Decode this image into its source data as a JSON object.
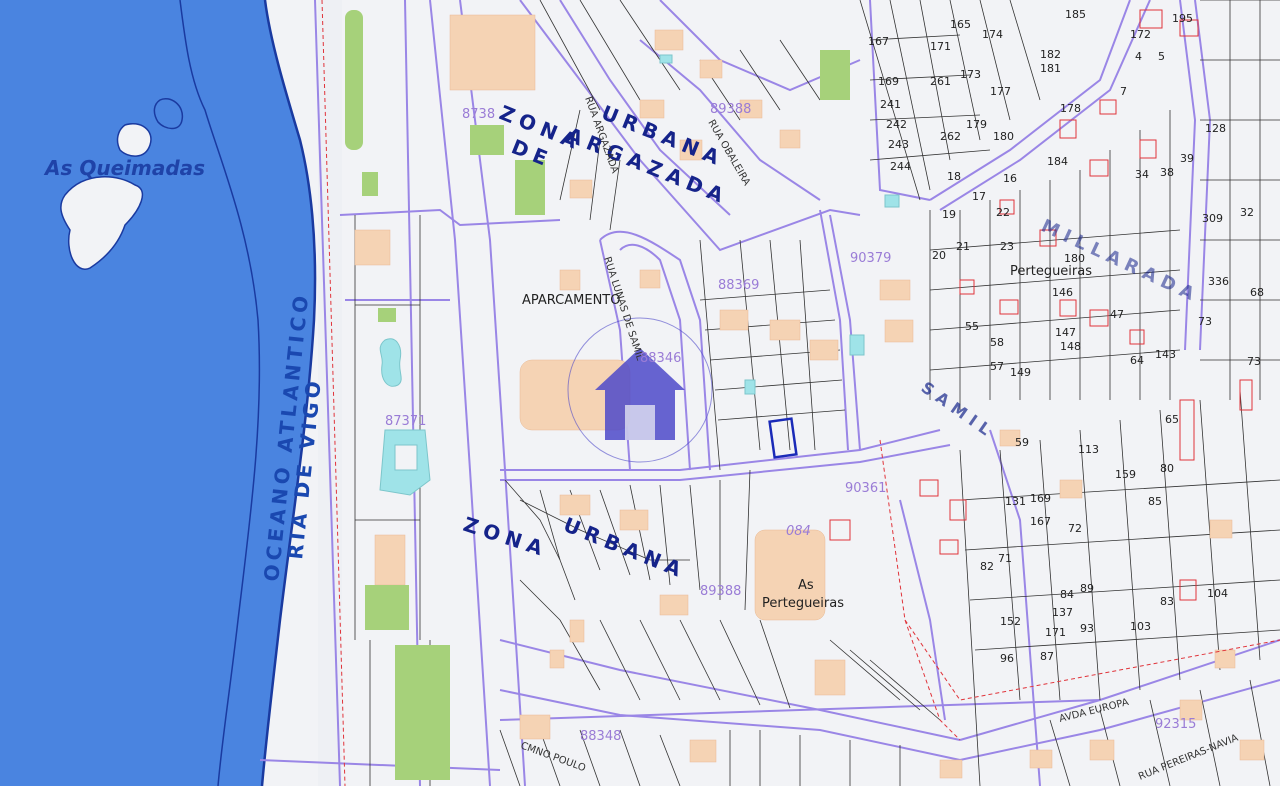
{
  "colors": {
    "sea": "#4a84e0",
    "land": "#f2f3f6",
    "road_edge": "#9a86e6",
    "building": "#f5d3b4",
    "green": "#a6d17a",
    "pool": "#9fe3e8",
    "coast": "#1a3aa0",
    "marker": "#4e49c9"
  },
  "places": {
    "island": "As Queimadas",
    "ocean_line1": "OCEANO ATLANTICO",
    "ocean_line2": "RIA DE VIGO",
    "parking": "APARCAMENTO",
    "pertegueiras_1": "As",
    "pertegueiras_2": "Pertegueiras",
    "pertegueiras_small": "Pertegueiras"
  },
  "zones": {
    "zone1_a": "ZONA",
    "zone1_b": "URBANA",
    "zone1_c": "DE",
    "zone1_d": "ARGAZADA",
    "zone2_a": "ZONA",
    "zone2_b": "URBANA",
    "millarada": "MILLARADA",
    "sami": "SAMIL"
  },
  "streets": {
    "rua_argazada": "RUA ARGAZADA",
    "rua_lagunas": "RUA LUNAS DE SAMIL",
    "rua_baleira": "RUA OBALEIRA",
    "avda_europa": "AVDA EUROPA",
    "cmno_poulo": "CMNO POULO",
    "rua_pereiras": "RUA PEREIRAS-NAVIA"
  },
  "plan_numbers": [
    {
      "id": "p1",
      "text": "8738"
    },
    {
      "id": "p2",
      "text": "89388"
    },
    {
      "id": "p3",
      "text": "90379"
    },
    {
      "id": "p4",
      "text": "88369"
    },
    {
      "id": "p5",
      "text": "88346"
    },
    {
      "id": "p6",
      "text": "87371"
    },
    {
      "id": "p7",
      "text": "90361"
    },
    {
      "id": "p8",
      "text": "084"
    },
    {
      "id": "p9",
      "text": "89388"
    },
    {
      "id": "p10",
      "text": "88348"
    },
    {
      "id": "p11",
      "text": "92315"
    }
  ],
  "parcels": [
    "167",
    "165",
    "171",
    "174",
    "185",
    "172",
    "195",
    "169",
    "261",
    "173",
    "177",
    "182",
    "181",
    "4",
    "5",
    "241",
    "242",
    "243",
    "244",
    "262",
    "179",
    "180",
    "178",
    "7",
    "128",
    "34",
    "38",
    "32",
    "39",
    "18",
    "17",
    "19",
    "22",
    "16",
    "184",
    "309",
    "20",
    "21",
    "23",
    "180",
    "336",
    "68",
    "146",
    "47",
    "55",
    "58",
    "147",
    "148",
    "64",
    "143",
    "73",
    "57",
    "149",
    "59",
    "113",
    "65",
    "159",
    "73",
    "80",
    "131",
    "169",
    "167",
    "72",
    "71",
    "82",
    "85",
    "84",
    "83",
    "104",
    "152",
    "171",
    "87",
    "89",
    "103",
    "96",
    "137",
    "93"
  ],
  "icons": [
    "home-marker-icon"
  ]
}
